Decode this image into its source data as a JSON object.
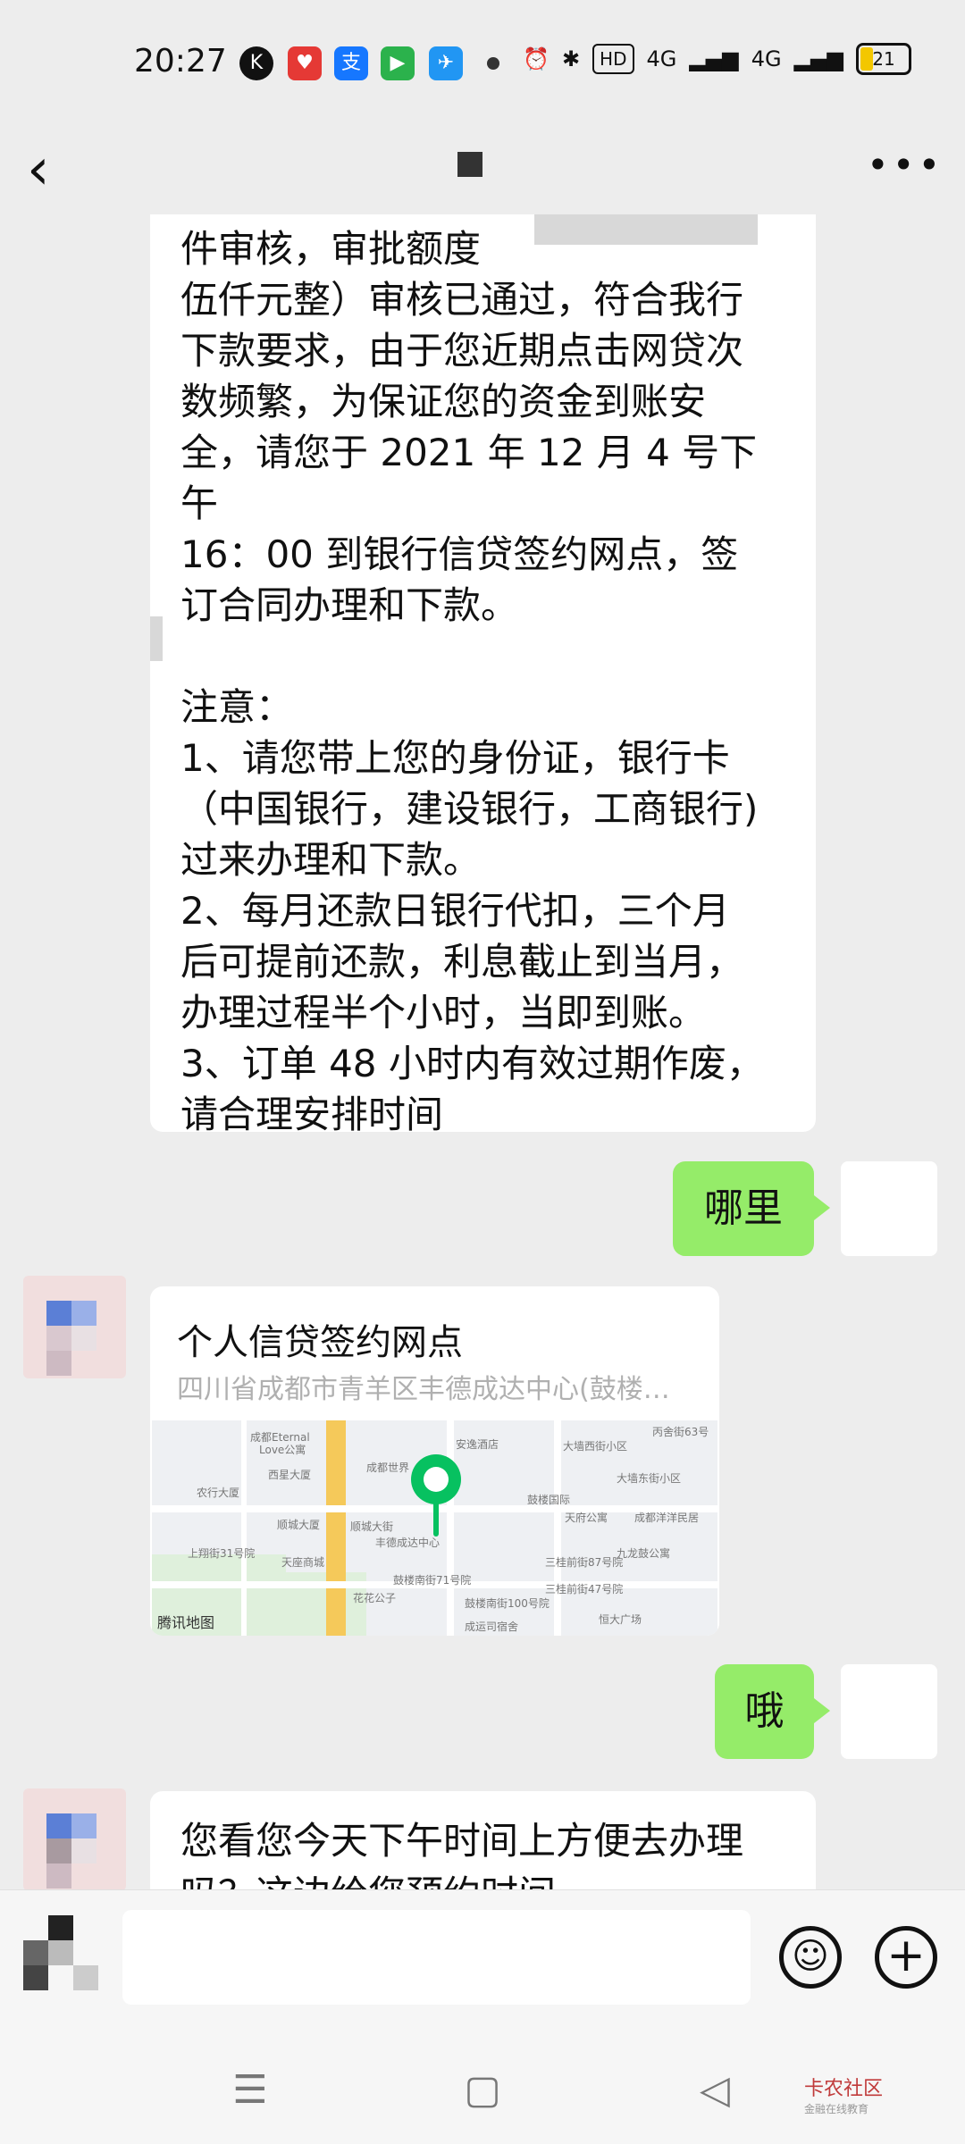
{
  "status_bar": {
    "time": "20:27",
    "hd_label": "HD",
    "network1": "4G",
    "network2": "4G",
    "battery": "21"
  },
  "nav": {
    "back_icon": "chevron-left",
    "more_icon": "ellipsis"
  },
  "messages": {
    "msg1_lines": [
      "件审核，审批额度",
      "伍仟元整）审核已通过，符合我行",
      "下款要求，由于您近期点击网贷次",
      "数频繁，为保证您的资金到账安",
      "全，请您于 2021 年 12 月 4 号下午",
      "16：00 到银行信贷签约网点，签",
      "订合同办理和下款。",
      "",
      "注意：",
      "1、请您带上您的身份证，银行卡",
      "（中国银行，建设银行，工商银行)",
      "过来办理和下款。",
      "2、每月还款日银行代扣，三个月",
      "后可提前还款，利息截止到当月，",
      "办理过程半个小时，当即到账。",
      "3、订单 48 小时内有效过期作废，",
      "请合理安排时间"
    ],
    "msg2_text": "哪里",
    "location": {
      "title": "个人信贷签约网点",
      "address": "四川省成都市青羊区丰德成达中心(鼓楼…",
      "map_labels": [
        "成都Eternal",
        "Love公寓",
        "西星大厦",
        "农行大厦",
        "顺城大厦",
        "天座商城",
        "上翔街31号院",
        "顺城大街",
        "安逸酒店",
        "成都世界",
        "丰德成达中心",
        "鼓楼南街71号院",
        "花花公子",
        "鼓楼国际",
        "天府公寓",
        "成都洋洋民居",
        "九龙鼓公寓",
        "三桂前街87号院",
        "三桂前街47号院",
        "恒大广场",
        "成运司宿舍",
        "丙舍街63号",
        "大墙西街小区",
        "大墙东街小区",
        "鼓楼南街100号院"
      ],
      "map_logo": "腾讯地图"
    },
    "msg4_text": "哦",
    "msg5_text": "您看您今天下午时间上方便去办理吗？这边给您预约时间"
  },
  "watermark": {
    "name": "卡农社区",
    "sub": "金融在线教育"
  },
  "colors": {
    "background": "#ededed",
    "my_bubble": "#95ec69",
    "map_pin": "#07c160"
  }
}
